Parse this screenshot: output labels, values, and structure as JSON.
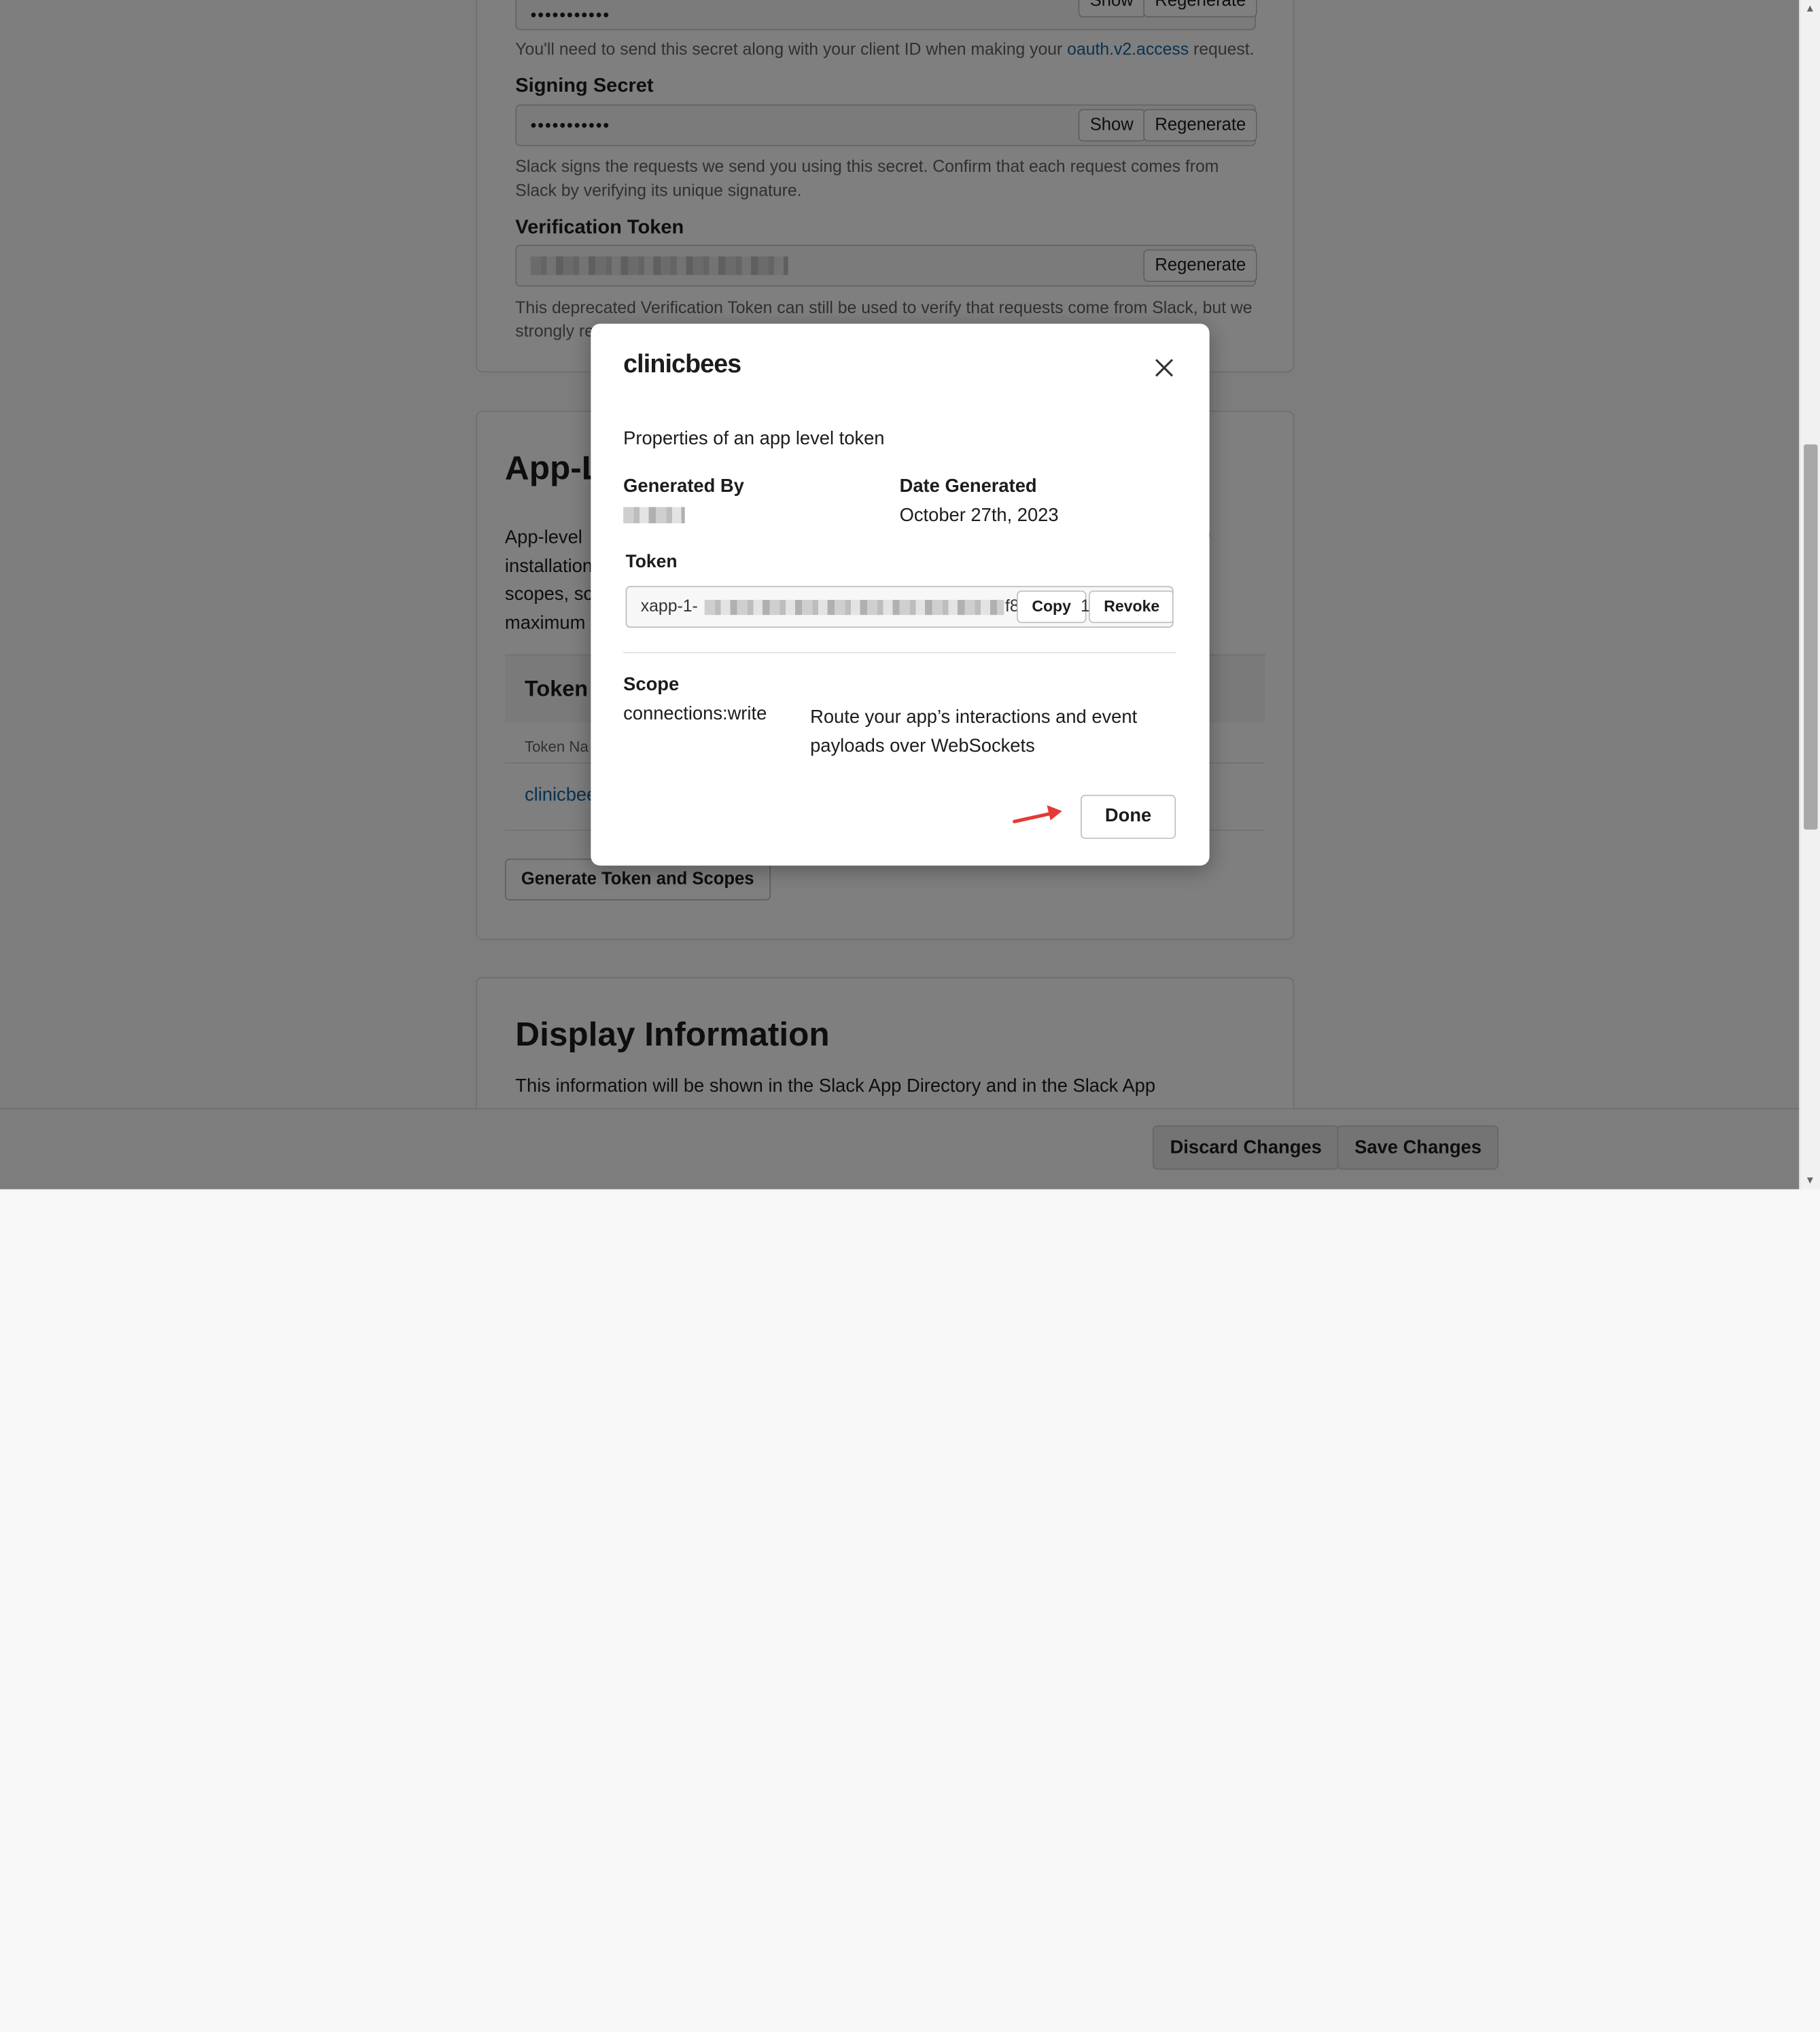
{
  "background": {
    "client_secret": {
      "value": "•••••••••••",
      "show_label": "Show",
      "regenerate_label": "Regenerate",
      "help_prefix": "You'll need to send this secret along with your client ID when making your ",
      "help_link": "oauth.v2.access",
      "help_suffix": " request."
    },
    "signing_secret": {
      "label": "Signing Secret",
      "value": "•••••••••••",
      "show_label": "Show",
      "regenerate_label": "Regenerate",
      "help": "Slack signs the requests we send you using this secret. Confirm that each request comes from Slack by verifying its unique signature."
    },
    "verification_token": {
      "label": "Verification Token",
      "regenerate_label": "Regenerate",
      "help_line1": "This deprecated Verification Token can still be used to verify that requests come from Slack, but we",
      "help_line2": "strongly re"
    },
    "app_level": {
      "heading": "App-L",
      "lines": [
        "App-level",
        "installation",
        "scopes, so",
        "maximum"
      ],
      "right_glyph": ")",
      "tokens_heading": "Token",
      "col_token_name": "Token Na",
      "row_name": "clinicbee",
      "generate_button": "Generate Token and Scopes"
    },
    "display_info": {
      "heading": "Display Information",
      "desc": "This information will be shown in the Slack App Directory and in the Slack App"
    }
  },
  "footer": {
    "discard_label": "Discard Changes",
    "save_label": "Save Changes"
  },
  "modal": {
    "title": "clinicbees",
    "subtitle": "Properties of an app level token",
    "generated_by_label": "Generated By",
    "date_generated_label": "Date Generated",
    "date_generated_value": "October 27th, 2023",
    "token_label": "Token",
    "token_prefix": "xapp-1-",
    "token_tail": "f8",
    "token_end": "1",
    "copy_label": "Copy",
    "revoke_label": "Revoke",
    "scope_label": "Scope",
    "scope_name": "connections:write",
    "scope_desc": "Route your app’s interactions and event payloads over WebSockets",
    "done_label": "Done",
    "close_icon": "close-icon",
    "pointer_icon": "red-arrow-icon",
    "pointer_color": "#e53935"
  }
}
